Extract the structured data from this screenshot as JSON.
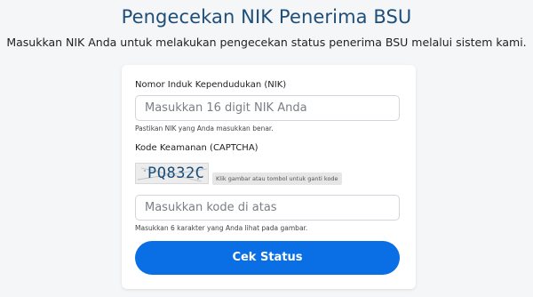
{
  "header": {
    "title": "Pengecekan NIK Penerima BSU",
    "subtitle": "Masukkan NIK Anda untuk melakukan pengecekan status penerima BSU melalui sistem kami."
  },
  "form": {
    "nik": {
      "label": "Nomor Induk Kependudukan (NIK)",
      "placeholder": "Masukkan 16 digit NIK Anda",
      "hint": "Pastikan NIK yang Anda masukkan benar."
    },
    "captcha": {
      "label": "Kode Keamanan (CAPTCHA)",
      "code": "PQ832C",
      "tip": "Klik gambar atau tombol untuk ganti kode",
      "placeholder": "Masukkan kode di atas",
      "hint": "Masukkan 6 karakter yang Anda lihat pada gambar."
    },
    "submit_label": "Cek Status"
  },
  "colors": {
    "title": "#1f4e79",
    "button": "#0a6fe5",
    "background": "#f4f6f8"
  }
}
